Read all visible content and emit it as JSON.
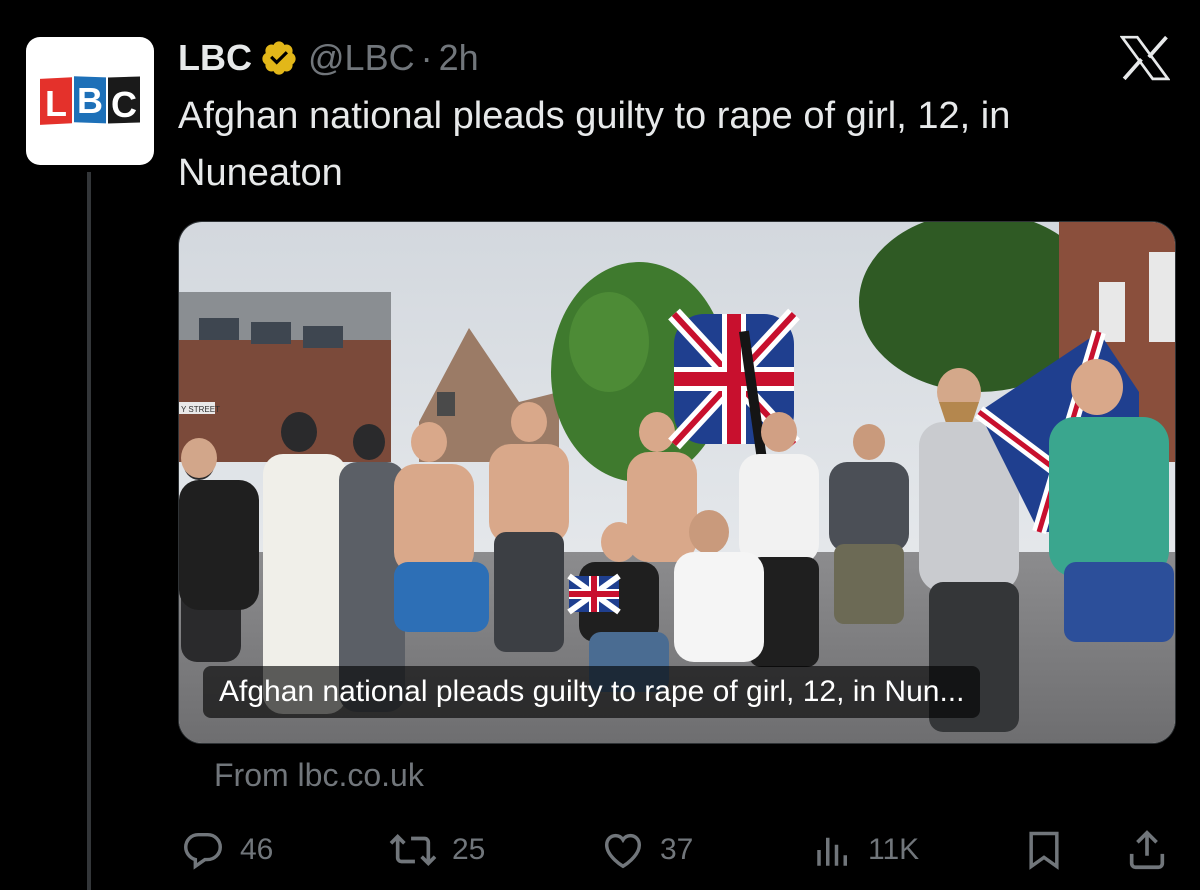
{
  "author": {
    "name": "LBC",
    "handle": "@LBC",
    "separator": "·",
    "time": "2h",
    "avatar_text": "LBC",
    "verified_color": "#e2b719"
  },
  "tweet": {
    "text": "Afghan national pleads guilty to rape of girl, 12, in Nuneaton"
  },
  "card": {
    "caption": "Afghan national pleads guilty to rape of girl, 12, in Nun...",
    "photo_sign": "Y STREET",
    "source": "From lbc.co.uk"
  },
  "actions": {
    "replies": "46",
    "reposts": "25",
    "likes": "37",
    "views": "11K"
  },
  "icons": [
    "verified-badge-icon",
    "x-logo-icon",
    "reply-icon",
    "repost-icon",
    "like-icon",
    "views-icon",
    "bookmark-icon",
    "share-icon"
  ],
  "colors": {
    "background": "#000000",
    "text": "#e7e9ea",
    "secondary": "#71767b",
    "brand_red": "#e4312b",
    "brand_blue": "#1d70b8",
    "brand_black": "#1a1a1a"
  }
}
